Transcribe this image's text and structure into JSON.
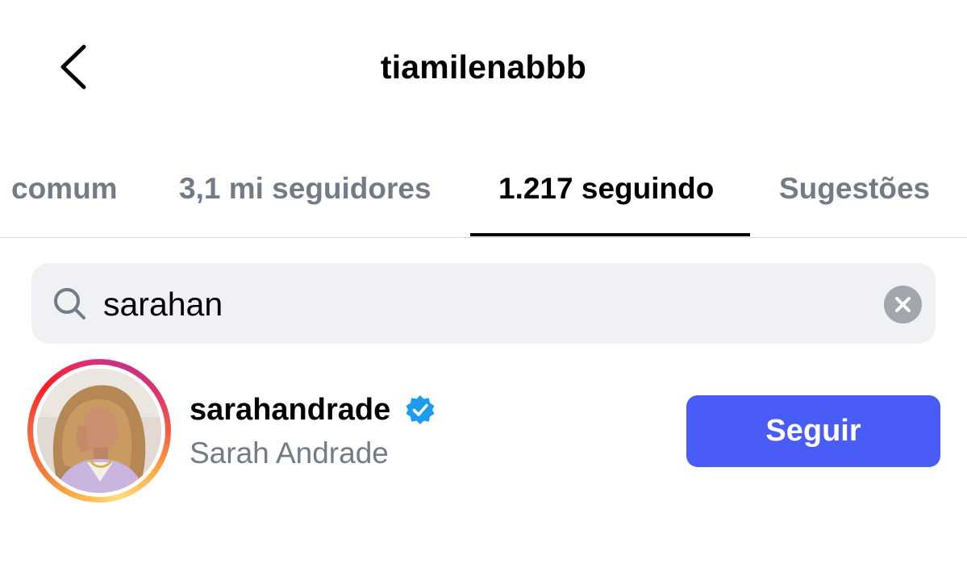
{
  "header": {
    "title": "tiamilenabbb",
    "back_icon": "chevron-left-icon"
  },
  "tabs": [
    {
      "label": "comum",
      "active": false
    },
    {
      "label": "3,1 mi seguidores",
      "active": false
    },
    {
      "label": "1.217 seguindo",
      "active": true
    },
    {
      "label": "Sugestões",
      "active": false
    }
  ],
  "search": {
    "value": "sarahan",
    "icon": "search-icon",
    "clear_icon": "clear-icon"
  },
  "results": [
    {
      "username": "sarahandrade",
      "full_name": "Sarah Andrade",
      "verified": true,
      "has_story_ring": true,
      "follow_label": "Seguir"
    }
  ],
  "colors": {
    "follow_button": "#4a5cf8",
    "verified_badge": "#1d9bf0",
    "inactive_tab": "#737b86",
    "search_background": "#eff1f4"
  }
}
